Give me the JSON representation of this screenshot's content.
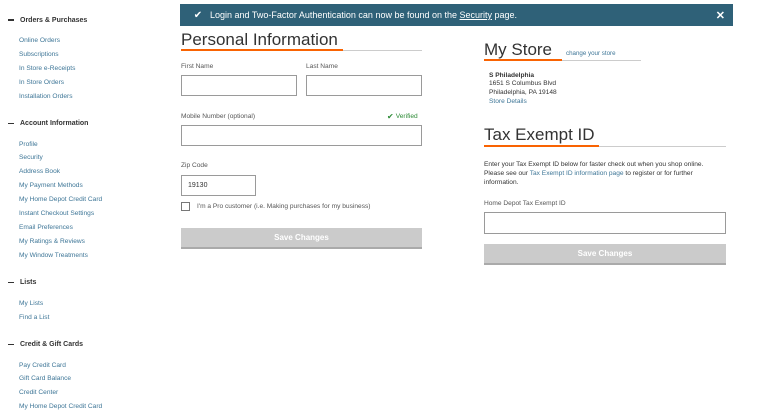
{
  "sidebar": {
    "sections": [
      {
        "title": "Orders & Purchases",
        "items": [
          "Online Orders",
          "Subscriptions",
          "In Store e-Receipts",
          "In Store Orders",
          "Installation Orders"
        ]
      },
      {
        "title": "Account Information",
        "items": [
          "Profile",
          "Security",
          "Address Book",
          "My Payment Methods",
          "My Home Depot Credit Card",
          "Instant Checkout Settings",
          "Email Preferences",
          "My Ratings & Reviews",
          "My Window Treatments"
        ]
      },
      {
        "title": "Lists",
        "items": [
          "My Lists",
          "Find a List"
        ]
      },
      {
        "title": "Credit & Gift Cards",
        "items": [
          "Pay Credit Card",
          "Gift Card Balance",
          "Credit Center",
          "My Home Depot Credit Card"
        ]
      }
    ]
  },
  "banner": {
    "message_before": "Login and Two-Factor Authentication can now be found on the ",
    "message_link": "Security",
    "message_after": " page.",
    "close": "✕"
  },
  "personal": {
    "title": "Personal Information",
    "first_name_label": "First Name",
    "first_name_value": "",
    "last_name_label": "Last Name",
    "last_name_value": "",
    "mobile_label": "Mobile Number (optional)",
    "mobile_value": "",
    "verified": "Verified",
    "zip_label": "Zip Code",
    "zip_value": "19130",
    "pro_label": "I'm a Pro customer (i.e. Making purchases for my business)",
    "pro_checked": false,
    "save": "Save Changes"
  },
  "store": {
    "title": "My Store",
    "change": "change your store",
    "name": "S Philadelphia",
    "address1": "1651 S Columbus Blvd",
    "address2": "Philadelphia, PA 19148",
    "details": "Store Details"
  },
  "tax": {
    "title": "Tax Exempt ID",
    "intro_line1": "Enter your Tax Exempt ID below for faster check out when you shop online.",
    "intro_before": "Please see our ",
    "intro_link": "Tax Exempt ID information page",
    "intro_after": " to register or for further information.",
    "field_label": "Home Depot Tax Exempt ID",
    "field_value": "",
    "save": "Save Changes"
  },
  "colors": {
    "banner_bg": "#2f6178",
    "accent_orange": "#f96302",
    "link_blue": "#3e7697",
    "verified_green": "#2d8b36",
    "disabled_button": "#cbcbcb"
  }
}
